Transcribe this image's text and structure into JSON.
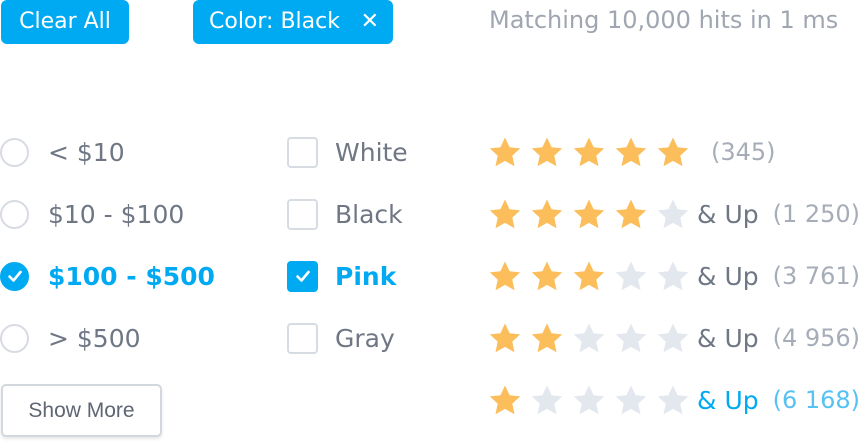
{
  "header": {
    "clear_all_label": "Clear All",
    "active_filter": {
      "label": "Color: Black",
      "close_glyph": "✕"
    },
    "stats_text": "Matching 10,000 hits in 1 ms"
  },
  "price_filter": {
    "options": [
      {
        "label": "< $10",
        "checked": false
      },
      {
        "label": "$10 - $100",
        "checked": false
      },
      {
        "label": "$100 - $500",
        "checked": true
      },
      {
        "label": "> $500",
        "checked": false
      }
    ],
    "show_more_label": "Show More"
  },
  "color_filter": {
    "options": [
      {
        "label": "White",
        "checked": false
      },
      {
        "label": "Black",
        "checked": false
      },
      {
        "label": "Pink",
        "checked": true
      },
      {
        "label": "Gray",
        "checked": false
      }
    ]
  },
  "rating_filter": {
    "options": [
      {
        "stars": 5,
        "suffix": "",
        "count": "(345)",
        "active": false
      },
      {
        "stars": 4,
        "suffix": "& Up",
        "count": "(1 250)",
        "active": false
      },
      {
        "stars": 3,
        "suffix": "& Up",
        "count": "(3 761)",
        "active": false
      },
      {
        "stars": 2,
        "suffix": "& Up",
        "count": "(4 956)",
        "active": false
      },
      {
        "stars": 1,
        "suffix": "& Up",
        "count": "(6 168)",
        "active": true
      }
    ]
  },
  "colors": {
    "accent": "#00aaf2",
    "star_filled": "#fbbe5b",
    "star_empty": "#e3e7ee",
    "text": "#6f7684",
    "muted": "#a6adb8",
    "border": "#d7dbe2"
  },
  "icons": {
    "close": "close-icon",
    "check": "checkmark-icon",
    "star": "star-icon"
  }
}
